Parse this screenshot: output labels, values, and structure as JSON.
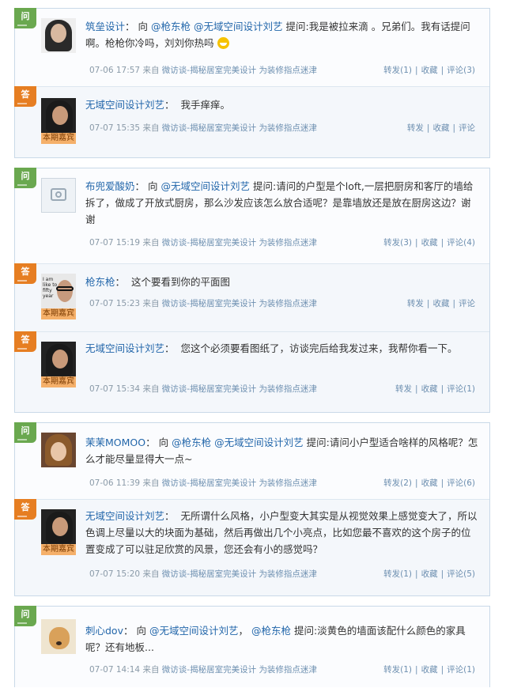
{
  "labels": {
    "q": "问",
    "a": "答",
    "guest_badge": "本期嘉宾",
    "from": "来自",
    "source": "微访谈-揭秘居室完美设计",
    "source2": "为装修指点迷津",
    "to": "向",
    "ask": "提问:",
    "repost": "转发",
    "fav": "收藏",
    "comment": "评论"
  },
  "threads": [
    {
      "q": {
        "name": "筑垒设计",
        "mentions": [
          "@枪东枪",
          "@无域空间设计刘艺"
        ],
        "text": "我是被拉来滴 。兄弟们。我有话提问啊。枪枪你冷吗，刘刘你热吗",
        "time": "07-06 17:57",
        "repost": "转发(1)",
        "fav": "收藏",
        "comment": "评论(3)"
      },
      "answers": [
        {
          "name": "无域空间设计刘艺",
          "text": "我手痒痒。",
          "time": "07-07 15:35",
          "repost": "转发",
          "fav": "收藏",
          "comment": "评论"
        }
      ]
    },
    {
      "q": {
        "name": "布兜爱酸奶",
        "mentions": [
          "@无域空间设计刘艺"
        ],
        "text": "请问的户型是个loft,一层把厨房和客厅的墙给拆了，做成了开放式厨房，那么沙发应该怎么放合适呢？是靠墙放还是放在厨房这边？谢谢",
        "time": "07-07 15:19",
        "repost": "转发(3)",
        "fav": "收藏",
        "comment": "评论(4)"
      },
      "answers": [
        {
          "name": "枪东枪",
          "text": "这个要看到你的平面图",
          "time": "07-07 15:23",
          "repost": "转发",
          "fav": "收藏",
          "comment": "评论"
        },
        {
          "name": "无域空间设计刘艺",
          "text": "您这个必须要看图纸了，访谈完后给我发过来，我帮你看一下。",
          "time": "07-07 15:34",
          "repost": "转发",
          "fav": "收藏",
          "comment": "评论(1)"
        }
      ]
    },
    {
      "q": {
        "name": "茉茉MOMOO",
        "mentions": [
          "@枪东枪",
          "@无域空间设计刘艺"
        ],
        "text": "请问小户型适合啥样的风格呢？怎么才能尽量显得大一点~",
        "time": "07-06 11:39",
        "repost": "转发(2)",
        "fav": "收藏",
        "comment": "评论(6)"
      },
      "answers": [
        {
          "name": "无域空间设计刘艺",
          "text": "无所谓什么风格，小户型变大其实是从视觉效果上感觉变大了，所以色调上尽量以大的块面为基础，然后再做出几个小亮点，比如您最不喜欢的这个房子的位置变成了可以驻足欣赏的风景，您还会有小的感觉吗？",
          "time": "07-07 15:20",
          "repost": "转发(1)",
          "fav": "收藏",
          "comment": "评论(5)"
        }
      ]
    },
    {
      "q": {
        "name": "刺心dov",
        "mentions": [
          "@无域空间设计刘艺",
          "@枪东枪"
        ],
        "text": "淡黄色的墙面该配什么颜色的家具呢？还有地板...",
        "time": "07-07 14:14",
        "repost": "转发(1)",
        "fav": "收藏",
        "comment": "评论(1)"
      },
      "answers": []
    }
  ]
}
